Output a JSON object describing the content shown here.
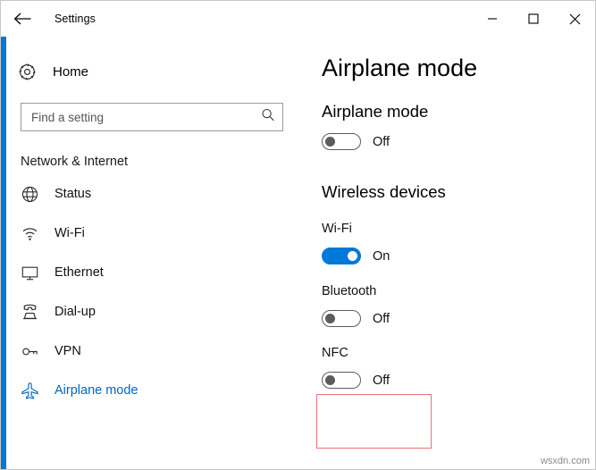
{
  "window": {
    "title": "Settings",
    "back_icon": "back-arrow-icon",
    "minimize_label": "–",
    "maximize_label": "□",
    "close_label": "✕",
    "accent_color": "#0078d7"
  },
  "sidebar": {
    "home": {
      "label": "Home",
      "icon": "gear-icon"
    },
    "search": {
      "value": "",
      "placeholder": "Find a setting",
      "icon": "search-icon"
    },
    "section_title": "Network & Internet",
    "items": [
      {
        "label": "Status",
        "icon": "status-globe-icon",
        "selected": false
      },
      {
        "label": "Wi-Fi",
        "icon": "wifi-icon",
        "selected": false
      },
      {
        "label": "Ethernet",
        "icon": "ethernet-icon",
        "selected": false
      },
      {
        "label": "Dial-up",
        "icon": "dialup-phone-icon",
        "selected": false
      },
      {
        "label": "VPN",
        "icon": "vpn-key-icon",
        "selected": false
      },
      {
        "label": "Airplane mode",
        "icon": "airplane-icon",
        "selected": true
      }
    ]
  },
  "main": {
    "page_title": "Airplane mode",
    "airplane_section": {
      "heading": "Airplane mode",
      "toggle_state": "Off",
      "toggle_on": false
    },
    "wireless_section": {
      "heading": "Wireless devices",
      "devices": [
        {
          "name": "Wi-Fi",
          "toggle_state": "On",
          "toggle_on": true,
          "highlighted": false
        },
        {
          "name": "Bluetooth",
          "toggle_state": "Off",
          "toggle_on": false,
          "highlighted": false
        },
        {
          "name": "NFC",
          "toggle_state": "Off",
          "toggle_on": false,
          "highlighted": true
        }
      ]
    }
  },
  "watermark": "wsxdn.com"
}
